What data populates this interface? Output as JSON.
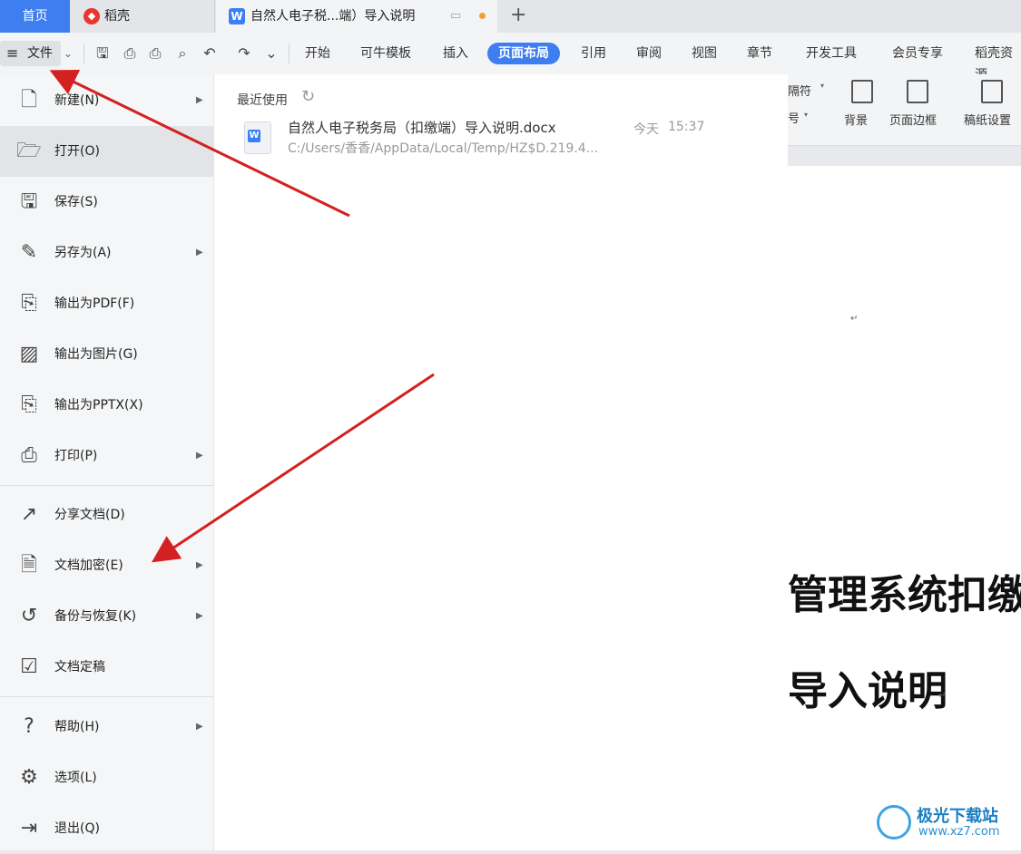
{
  "tabs": {
    "home": "首页",
    "daoke": "稻壳",
    "doc_title": "自然人电子税...端）导入说明",
    "add": "+"
  },
  "toolbar": {
    "file_label": "文件",
    "menus": [
      "开始",
      "可牛模板",
      "插入",
      "页面布局",
      "引用",
      "审阅",
      "视图",
      "章节",
      "开发工具",
      "会员专享",
      "稻壳资源"
    ],
    "active_menu": "页面布局"
  },
  "ribbon": {
    "partial_separator": "隔符",
    "partial_number": "号",
    "background": "背景",
    "page_border": "页面边框",
    "paper_setting": "稿纸设置"
  },
  "file_menu": {
    "items": [
      {
        "label": "新建(N)",
        "icon": "new-doc-icon",
        "submenu": true
      },
      {
        "label": "打开(O)",
        "icon": "folder-open-icon",
        "submenu": false
      },
      {
        "label": "保存(S)",
        "icon": "save-icon",
        "submenu": false
      },
      {
        "label": "另存为(A)",
        "icon": "save-as-icon",
        "submenu": true
      },
      {
        "label": "输出为PDF(F)",
        "icon": "export-pdf-icon",
        "submenu": false
      },
      {
        "label": "输出为图片(G)",
        "icon": "export-image-icon",
        "submenu": false
      },
      {
        "label": "输出为PPTX(X)",
        "icon": "export-pptx-icon",
        "submenu": false
      },
      {
        "label": "打印(P)",
        "icon": "print-icon",
        "submenu": true
      },
      {
        "label": "分享文档(D)",
        "icon": "share-icon",
        "submenu": false
      },
      {
        "label": "文档加密(E)",
        "icon": "encrypt-icon",
        "submenu": true
      },
      {
        "label": "备份与恢复(K)",
        "icon": "backup-icon",
        "submenu": true
      },
      {
        "label": "文档定稿",
        "icon": "finalize-icon",
        "submenu": false
      },
      {
        "label": "帮助(H)",
        "icon": "help-icon",
        "submenu": true
      },
      {
        "label": "选项(L)",
        "icon": "gear-icon",
        "submenu": false
      },
      {
        "label": "退出(Q)",
        "icon": "exit-icon",
        "submenu": false
      }
    ]
  },
  "recent": {
    "title": "最近使用",
    "file_name": "自然人电子税务局（扣缴端）导入说明.docx",
    "file_path": "C:/Users/香香/AppData/Local/Temp/HZ$D.219.4...",
    "day": "今天",
    "time": "15:37"
  },
  "document": {
    "heading1": "管理系统扣缴",
    "heading2": "导入说明",
    "para_mark": "↵"
  },
  "watermark": {
    "name": "极光下载站",
    "url": "www.xz7.com"
  },
  "colors": {
    "accent": "#3e7ef0",
    "arrow": "#d42020"
  }
}
